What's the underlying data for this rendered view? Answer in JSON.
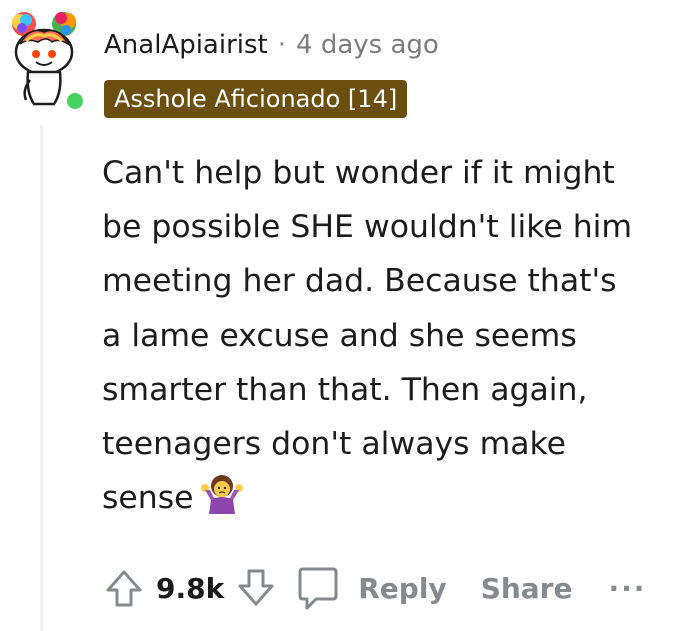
{
  "comment": {
    "author": "AnalApiairist",
    "separator": "·",
    "time_ago": "4 days ago",
    "flair": "Asshole Aficionado [14]",
    "body_lines": [
      "Can't help but wonder if it might",
      "be possible SHE wouldn't like him",
      "meeting her dad. Because that's",
      "a lame excuse and she seems",
      "smarter than that. Then again,",
      "teenagers don't always make",
      "sense"
    ],
    "emoji_name": "person-shrugging-emoji"
  },
  "actions": {
    "vote_count": "9.8k",
    "reply_label": "Reply",
    "share_label": "Share",
    "more_label": "···"
  },
  "colors": {
    "flair_bg": "#6b4f0f",
    "online": "#46d160",
    "muted": "#878a8c",
    "text": "#1c1c1c"
  },
  "icons": {
    "upvote": "arrow-up-icon",
    "downvote": "arrow-down-icon",
    "reply": "speech-bubble-icon",
    "more": "more-dots-icon"
  }
}
